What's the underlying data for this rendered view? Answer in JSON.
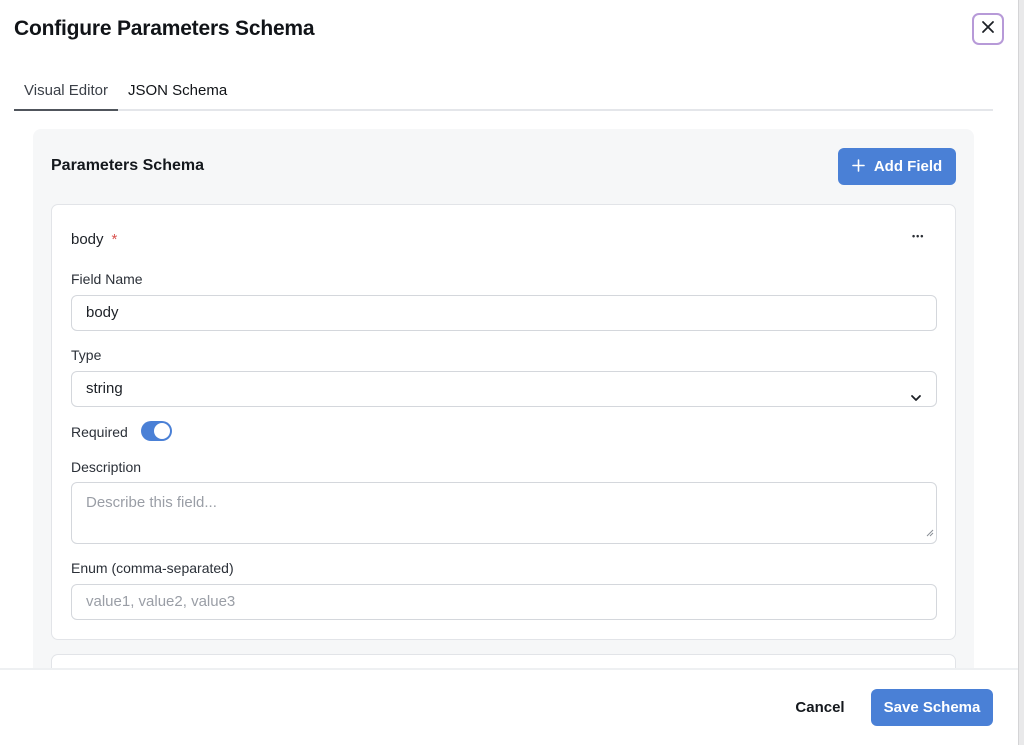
{
  "dialog": {
    "title": "Configure Parameters Schema",
    "close_icon": "close-icon"
  },
  "tabs": [
    {
      "label": "Visual Editor",
      "active": true
    },
    {
      "label": "JSON Schema",
      "active": false
    }
  ],
  "panel": {
    "title": "Parameters Schema",
    "add_button_label": "Add Field",
    "add_icon": "plus-icon"
  },
  "field": {
    "header_name": "body",
    "required_marker": "*",
    "more_icon": "more-horizontal-icon",
    "more_label": "•••",
    "name_label": "Field Name",
    "name_value": "body",
    "type_label": "Type",
    "type_value": "string",
    "required_label": "Required",
    "required_on": true,
    "description_label": "Description",
    "description_placeholder": "Describe this field...",
    "enum_label": "Enum (comma-separated)",
    "enum_placeholder": "value1, value2, value3"
  },
  "footer": {
    "cancel_label": "Cancel",
    "save_label": "Save Schema"
  },
  "colors": {
    "accent": "#4a80d6",
    "required_star": "#d9534f",
    "close_border": "#b79ad8"
  }
}
